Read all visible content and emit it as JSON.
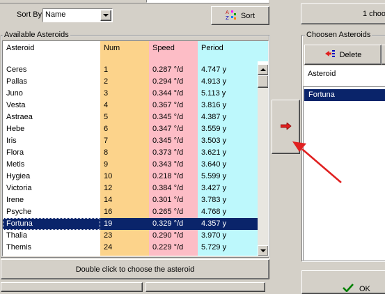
{
  "sort": {
    "label": "Sort By",
    "selected": "Name",
    "button_label": "Sort"
  },
  "top_right_text": "1 choo",
  "available": {
    "group_title": "Available Asteroids",
    "columns": [
      "Asteroid",
      "Num",
      "Speed",
      "Period"
    ],
    "rows": [
      {
        "name": "Ceres",
        "num": "1",
        "speed": "0.287 °/d",
        "period": "4.747 y"
      },
      {
        "name": "Pallas",
        "num": "2",
        "speed": "0.294 °/d",
        "period": "4.913 y"
      },
      {
        "name": "Juno",
        "num": "3",
        "speed": "0.344 °/d",
        "period": "5.113 y"
      },
      {
        "name": "Vesta",
        "num": "4",
        "speed": "0.367 °/d",
        "period": "3.816 y"
      },
      {
        "name": "Astraea",
        "num": "5",
        "speed": "0.345 °/d",
        "period": "4.387 y"
      },
      {
        "name": "Hebe",
        "num": "6",
        "speed": "0.347 °/d",
        "period": "3.559 y"
      },
      {
        "name": "Iris",
        "num": "7",
        "speed": "0.345 °/d",
        "period": "3.503 y"
      },
      {
        "name": "Flora",
        "num": "8",
        "speed": "0.373 °/d",
        "period": "3.621 y"
      },
      {
        "name": "Metis",
        "num": "9",
        "speed": "0.343 °/d",
        "period": "3.640 y"
      },
      {
        "name": "Hygiea",
        "num": "10",
        "speed": "0.218 °/d",
        "period": "5.599 y"
      },
      {
        "name": "Victoria",
        "num": "12",
        "speed": "0.384 °/d",
        "period": "3.427 y"
      },
      {
        "name": "Irene",
        "num": "14",
        "speed": "0.301 °/d",
        "period": "3.783 y"
      },
      {
        "name": "Psyche",
        "num": "16",
        "speed": "0.265 °/d",
        "period": "4.768 y"
      },
      {
        "name": "Fortuna",
        "num": "19",
        "speed": "0.329 °/d",
        "period": "4.357 y",
        "selected": true
      },
      {
        "name": "Thalia",
        "num": "23",
        "speed": "0.290 °/d",
        "period": "3.970 y"
      },
      {
        "name": "Themis",
        "num": "24",
        "speed": "0.229 °/d",
        "period": "5.729 y"
      }
    ],
    "hint": "Double click to choose the asteroid"
  },
  "chosen": {
    "group_title": "Choosen Asteroids",
    "delete_label": "Delete",
    "column": "Asteroid",
    "items": [
      "Fortuna"
    ]
  },
  "ok_label": "OK",
  "colors": {
    "num_col": "#fcd38b",
    "speed_col": "#fdbdc6",
    "period_col": "#bdf8fc",
    "selection": "#0a246a",
    "annotation_arrow": "#e02020"
  }
}
